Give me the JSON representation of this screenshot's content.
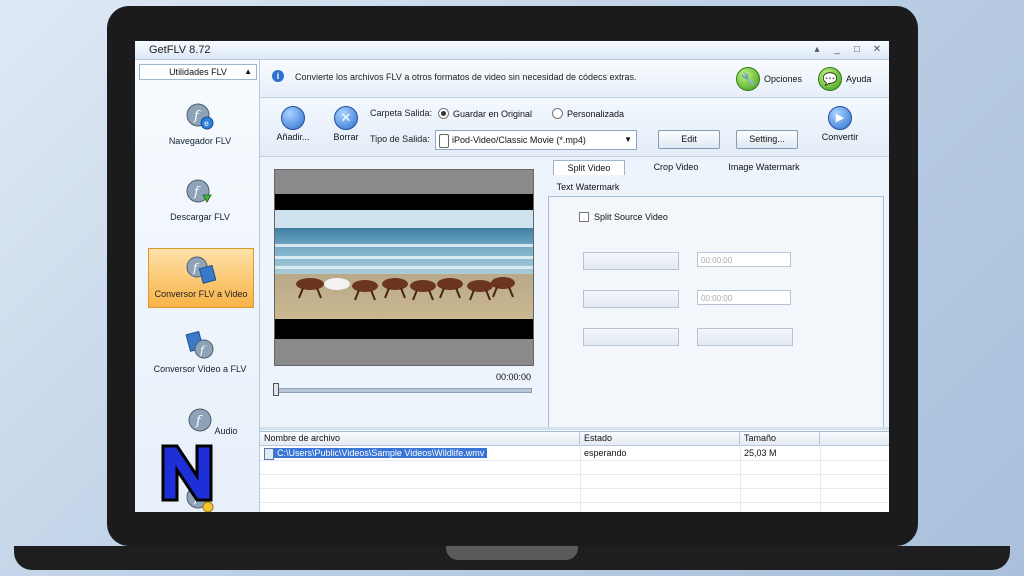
{
  "app": {
    "title": "GetFLV 8.72",
    "win_buttons": [
      "▴",
      "_",
      "□",
      "✕"
    ]
  },
  "sidebar": {
    "dropdown_label": "Utilidades FLV",
    "items": [
      {
        "label": "Navegador FLV",
        "icon": "flv-browser-icon"
      },
      {
        "label": "Descargar FLV",
        "icon": "flv-download-icon"
      },
      {
        "label": "Conversor FLV a Video",
        "icon": "flv-to-video-icon",
        "active": true
      },
      {
        "label": "Conversor Video a FLV",
        "icon": "video-to-flv-icon"
      },
      {
        "label": "Audio",
        "icon": "flv-audio-icon"
      }
    ],
    "overlay_logo": "N"
  },
  "topbar": {
    "info_text": "Convierte los archivos FLV a otros formatos de video sin necesidad de códecs extras.",
    "options_label": "Opciones",
    "help_label": "Ayuda"
  },
  "toolbar": {
    "add_label": "Añadir...",
    "delete_label": "Borrar",
    "output_folder_label": "Carpeta Salida:",
    "save_original_label": "Guardar en Original",
    "custom_label": "Personalizada",
    "output_type_label": "Tipo de Salida:",
    "output_type_value": "iPod-Video/Classic Movie (*.mp4)",
    "edit_label": "Edit",
    "setting_label": "Setting...",
    "convert_label": "Convertir"
  },
  "preview": {
    "time": "00:00:00",
    "position": 0
  },
  "tabs": {
    "items": [
      "Split Video",
      "Crop Video",
      "Image Watermark",
      "Text Watermark"
    ],
    "active": "Split Video",
    "split_source_label": "Split Source Video",
    "start_time": "00:00:00",
    "end_time": "00:00:00"
  },
  "filelist": {
    "columns": [
      "Nombre de archivo",
      "Estado",
      "Tamaño"
    ],
    "rows": [
      {
        "name": "C:\\Users\\Public\\Videos\\Sample Videos\\Wildlife.wmv",
        "status": "esperando",
        "size": "25,03 M"
      }
    ]
  },
  "colors": {
    "accent": "#3875d7",
    "active_item": "#f7b347",
    "frame": "#1b1b1d"
  }
}
